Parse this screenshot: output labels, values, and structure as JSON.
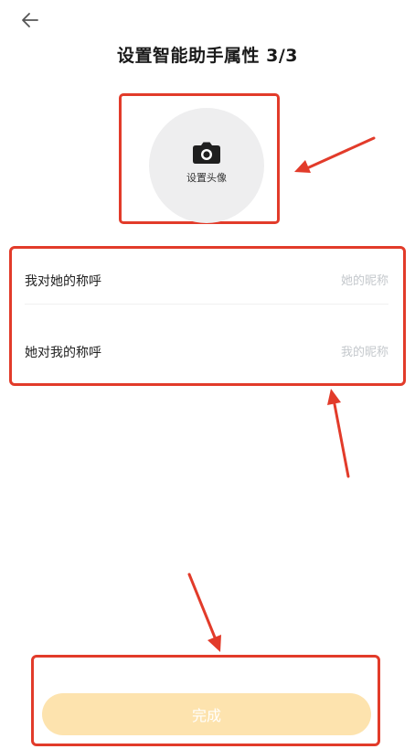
{
  "header": {
    "title": "设置智能助手属性 3/3",
    "back_icon": "arrow-left-icon"
  },
  "avatar": {
    "label": "设置头像",
    "icon": "camera-icon"
  },
  "form": {
    "rows": [
      {
        "label": "我对她的称呼",
        "placeholder": "她的昵称",
        "value": ""
      },
      {
        "label": "她对我的称呼",
        "placeholder": "我的昵称",
        "value": ""
      }
    ]
  },
  "footer": {
    "submit_label": "完成"
  },
  "colors": {
    "accent_disabled": "#fde3ae",
    "annotation": "#e23b2a",
    "avatar_bg": "#eeeeef",
    "placeholder": "#c4c8cc"
  }
}
